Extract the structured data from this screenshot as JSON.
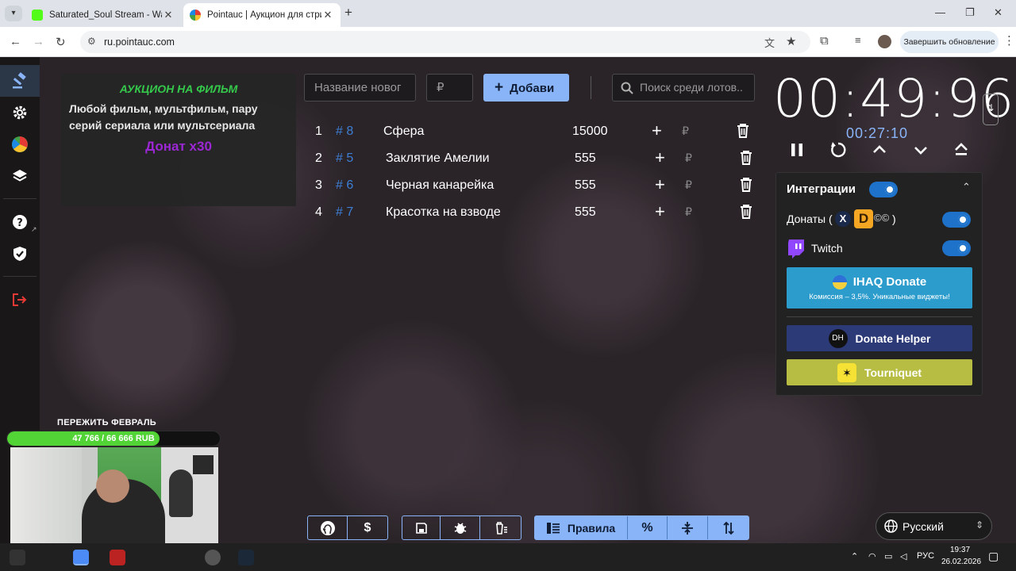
{
  "browser": {
    "tabs": [
      {
        "title": "Saturated_Soul Stream - Watch",
        "active": false
      },
      {
        "title": "Pointauc | Аукцион для стриме",
        "active": true
      }
    ],
    "url": "ru.pointauc.com",
    "update_label": "Завершить обновление"
  },
  "auction": {
    "description": {
      "heading": "АУКЦИОН НА ФИЛЬМ",
      "text": "Любой фильм, мультфильм, пару серий сериала или мультсериала",
      "multiplier": "Донат х30"
    },
    "new_lot_placeholder": "Название новог",
    "amount_placeholder": "₽",
    "add_label": "Добави",
    "search_placeholder": "Поиск среди лотов..",
    "lots": [
      {
        "num": "1",
        "id": "# 8",
        "name": "Сфера",
        "amount": "15000"
      },
      {
        "num": "2",
        "id": "# 5",
        "name": "Заклятие Амелии",
        "amount": "555"
      },
      {
        "num": "3",
        "id": "# 6",
        "name": "Черная канарейка",
        "amount": "555"
      },
      {
        "num": "4",
        "id": "# 7",
        "name": "Красотка на взводе",
        "amount": "555"
      }
    ],
    "currency": "₽"
  },
  "timer": {
    "main": "00:49:96",
    "sub": "00:27:10"
  },
  "integrations": {
    "title": "Интеграции",
    "enabled": true,
    "donations_label": "Донаты (",
    "donations_close": ")",
    "donations_enabled": true,
    "twitch_label": "Twitch",
    "twitch_enabled": true,
    "ihaq_title": "IHAQ Donate",
    "ihaq_subtitle": "Комиссия – 3,5%. Уникальные виджеты!",
    "donate_helper": "Donate Helper",
    "tourniquet": "Tourniquet"
  },
  "toolbar": {
    "rules_label": "Правила"
  },
  "language": "Русский",
  "stream_overlay": {
    "goal_title": "ПЕРЕЖИТЬ ФЕВРАЛЬ",
    "goal_text": "47 766 / 66 666 RUB",
    "goal_progress": 0.7165
  },
  "taskbar": {
    "lang": "РУС",
    "time": "19:37",
    "date": "26.02.2026"
  },
  "colors": {
    "accent": "#8ab4f8",
    "lot_id": "#3d7fd6",
    "heading_green": "#34c94b",
    "multiplier_purple": "#9c27d4",
    "ihaq": "#2c9ccc",
    "donate_helper": "#2d3a78",
    "tourniquet": "#b7bd43"
  }
}
